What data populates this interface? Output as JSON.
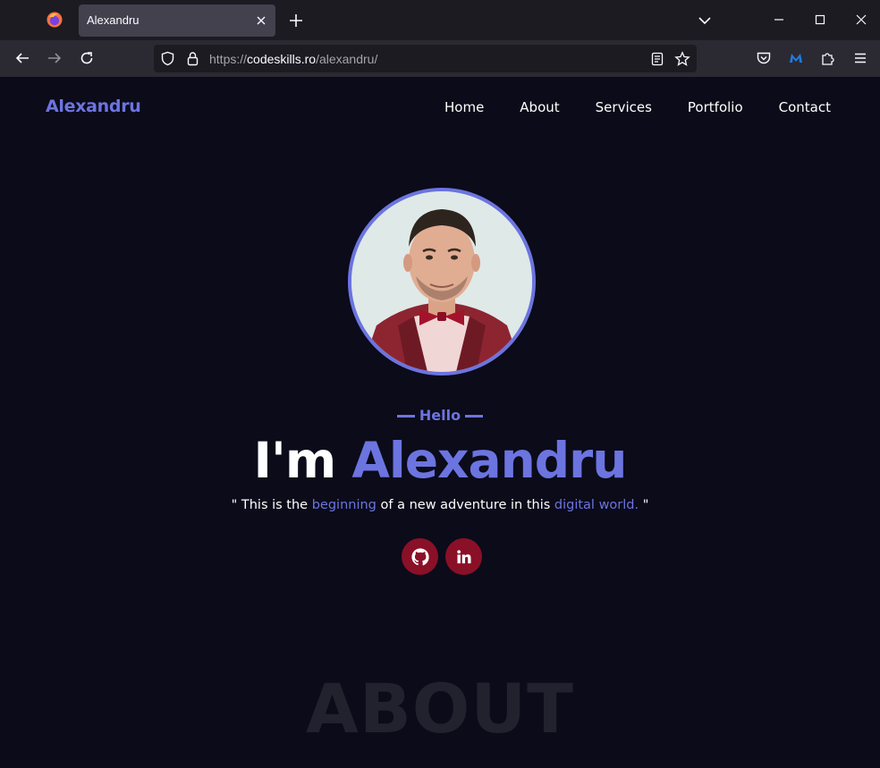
{
  "browser": {
    "tab_title": "Alexandru",
    "url_prefix": "https://",
    "url_host": "codeskills.ro",
    "url_path": "/alexandru/"
  },
  "site": {
    "brand": "Alexandru",
    "nav": [
      "Home",
      "About",
      "Services",
      "Portfolio",
      "Contact"
    ]
  },
  "hero": {
    "greeting": "Hello",
    "headline_prefix": "I'm",
    "headline_name": "Alexandru",
    "tagline_open": "\" This is the",
    "tagline_hl1": "beginning",
    "tagline_mid": "of a new adventure in this",
    "tagline_hl2": "digital world.",
    "tagline_close": "\"",
    "socials": [
      "github-icon",
      "linkedin-icon"
    ]
  },
  "about": {
    "ghost_title": "ABOUT"
  },
  "colors": {
    "accent": "#6c74e0",
    "page_bg": "#0b0b1a",
    "social_bg": "#8a1028",
    "ghost_text": "#22212e"
  }
}
